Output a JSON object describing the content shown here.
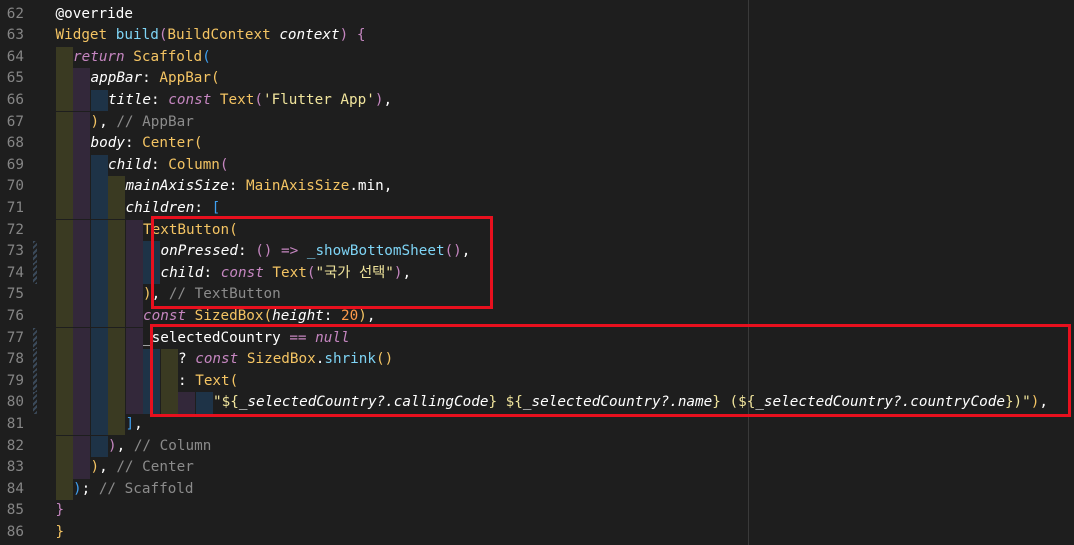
{
  "editor": {
    "lines": [
      {
        "n": "62",
        "indent": 0,
        "tokens": [
          [
            "@override",
            "pu"
          ]
        ]
      },
      {
        "n": "63",
        "indent": 0,
        "tokens": [
          [
            "Widget ",
            "ty"
          ],
          [
            "build",
            "fn"
          ],
          [
            "(",
            "b2"
          ],
          [
            "BuildContext ",
            "ty"
          ],
          [
            "context",
            "pr"
          ],
          [
            ") ",
            "b2"
          ],
          [
            "{",
            "b2"
          ]
        ]
      },
      {
        "n": "64",
        "indent": 1,
        "tokens": [
          [
            "return ",
            "kw"
          ],
          [
            "Scaffold",
            "ty"
          ],
          [
            "(",
            "b3"
          ]
        ]
      },
      {
        "n": "65",
        "indent": 2,
        "tokens": [
          [
            "appBar",
            "pr"
          ],
          [
            ": ",
            "pu"
          ],
          [
            "AppBar",
            "ty"
          ],
          [
            "(",
            "b1"
          ]
        ]
      },
      {
        "n": "66",
        "indent": 3,
        "tokens": [
          [
            "title",
            "pr"
          ],
          [
            ": ",
            "pu"
          ],
          [
            "const ",
            "kw"
          ],
          [
            "Text",
            "ty"
          ],
          [
            "(",
            "b2"
          ],
          [
            "'Flutter App'",
            "st"
          ],
          [
            ")",
            "b2"
          ],
          [
            ",",
            "pu"
          ]
        ]
      },
      {
        "n": "67",
        "indent": 2,
        "tokens": [
          [
            ")",
            "b1"
          ],
          [
            ", ",
            "pu"
          ],
          [
            "// AppBar",
            "cm"
          ]
        ]
      },
      {
        "n": "68",
        "indent": 2,
        "tokens": [
          [
            "body",
            "pr"
          ],
          [
            ": ",
            "pu"
          ],
          [
            "Center",
            "ty"
          ],
          [
            "(",
            "b1"
          ]
        ]
      },
      {
        "n": "69",
        "indent": 3,
        "tokens": [
          [
            "child",
            "pr"
          ],
          [
            ": ",
            "pu"
          ],
          [
            "Column",
            "ty"
          ],
          [
            "(",
            "b2"
          ]
        ]
      },
      {
        "n": "70",
        "indent": 4,
        "tokens": [
          [
            "mainAxisSize",
            "pr"
          ],
          [
            ": ",
            "pu"
          ],
          [
            "MainAxisSize",
            "ty"
          ],
          [
            ".",
            "pu"
          ],
          [
            "min",
            "pu"
          ],
          [
            ",",
            "pu"
          ]
        ]
      },
      {
        "n": "71",
        "indent": 4,
        "tokens": [
          [
            "children",
            "pr"
          ],
          [
            ": ",
            "pu"
          ],
          [
            "[",
            "b3"
          ]
        ]
      },
      {
        "n": "72",
        "indent": 5,
        "tokens": [
          [
            "TextButton",
            "ty"
          ],
          [
            "(",
            "b1"
          ]
        ]
      },
      {
        "n": "73",
        "indent": 6,
        "tokens": [
          [
            "onPressed",
            "pr"
          ],
          [
            ": ",
            "pu"
          ],
          [
            "()",
            "b2"
          ],
          [
            " => ",
            "op"
          ],
          [
            "_showBottomSheet",
            "fn"
          ],
          [
            "()",
            "b2"
          ],
          [
            ",",
            "pu"
          ]
        ]
      },
      {
        "n": "74",
        "indent": 6,
        "tokens": [
          [
            "child",
            "pr"
          ],
          [
            ": ",
            "pu"
          ],
          [
            "const ",
            "kw"
          ],
          [
            "Text",
            "ty"
          ],
          [
            "(",
            "b2"
          ],
          [
            "\"국가 선택\"",
            "st"
          ],
          [
            ")",
            "b2"
          ],
          [
            ",",
            "pu"
          ]
        ]
      },
      {
        "n": "75",
        "indent": 5,
        "tokens": [
          [
            ")",
            "b1"
          ],
          [
            ", ",
            "pu"
          ],
          [
            "// TextButton",
            "cm"
          ]
        ]
      },
      {
        "n": "76",
        "indent": 5,
        "tokens": [
          [
            "const ",
            "kw"
          ],
          [
            "SizedBox",
            "ty"
          ],
          [
            "(",
            "b1"
          ],
          [
            "height",
            "pr"
          ],
          [
            ": ",
            "pu"
          ],
          [
            "20",
            "nm"
          ],
          [
            ")",
            "b1"
          ],
          [
            ",",
            "pu"
          ]
        ]
      },
      {
        "n": "77",
        "indent": 5,
        "tokens": [
          [
            "_selectedCountry ",
            "pu"
          ],
          [
            "== ",
            "op"
          ],
          [
            "null",
            "kw"
          ]
        ]
      },
      {
        "n": "78",
        "indent": 7,
        "tokens": [
          [
            "? ",
            "pu"
          ],
          [
            "const ",
            "kw"
          ],
          [
            "SizedBox",
            "ty"
          ],
          [
            ".",
            "pu"
          ],
          [
            "shrink",
            "fn"
          ],
          [
            "()",
            "b1"
          ]
        ]
      },
      {
        "n": "79",
        "indent": 7,
        "tokens": [
          [
            ": ",
            "pu"
          ],
          [
            "Text",
            "ty"
          ],
          [
            "(",
            "b1"
          ]
        ]
      },
      {
        "n": "80",
        "indent": 9,
        "tokens": [
          [
            "\"${",
            "st"
          ],
          [
            "_selectedCountry?.callingCode",
            "pr"
          ],
          [
            "} ${",
            "st"
          ],
          [
            "_selectedCountry?.name",
            "pr"
          ],
          [
            "} (${",
            "st"
          ],
          [
            "_selectedCountry?.countryCode",
            "pr"
          ],
          [
            "})\"",
            "st"
          ],
          [
            ")",
            "b1"
          ],
          [
            ",",
            "pu"
          ]
        ]
      },
      {
        "n": "81",
        "indent": 4,
        "tokens": [
          [
            "]",
            "b3"
          ],
          [
            ",",
            "pu"
          ]
        ]
      },
      {
        "n": "82",
        "indent": 3,
        "tokens": [
          [
            ")",
            "b2"
          ],
          [
            ", ",
            "pu"
          ],
          [
            "// Column",
            "cm"
          ]
        ]
      },
      {
        "n": "83",
        "indent": 2,
        "tokens": [
          [
            ")",
            "b1"
          ],
          [
            ", ",
            "pu"
          ],
          [
            "// Center",
            "cm"
          ]
        ]
      },
      {
        "n": "84",
        "indent": 1,
        "tokens": [
          [
            ")",
            "b3"
          ],
          [
            "; ",
            "pu"
          ],
          [
            "// Scaffold",
            "cm"
          ]
        ]
      },
      {
        "n": "85",
        "indent": 0,
        "tokens": [
          [
            "}",
            "b2"
          ]
        ]
      },
      {
        "n": "86",
        "indent": 0,
        "tokens": [
          [
            "}",
            "b1"
          ]
        ]
      }
    ]
  },
  "highlights": [
    {
      "name": "highlight-textbutton-box",
      "from_line": "72",
      "to_line": "75"
    },
    {
      "name": "highlight-selected-country-box",
      "from_line": "77",
      "to_line": "80"
    }
  ],
  "colors": {
    "background": "#1e1e1e",
    "highlight": "#e8101e",
    "line_number": "#858585"
  }
}
